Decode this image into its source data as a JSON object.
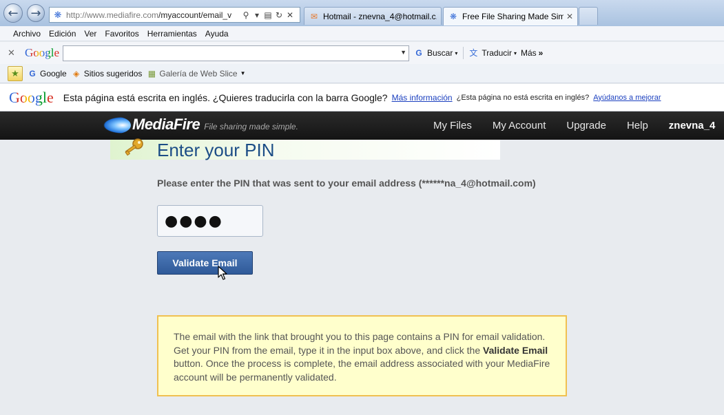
{
  "browser": {
    "address": {
      "url_domain": "http://www.mediafire.com",
      "url_path": "/myaccount/email_v"
    },
    "tabs": [
      {
        "title": "Hotmail - znevna_4@hotmail.c..."
      },
      {
        "title": "Free File Sharing Made Sim..."
      }
    ]
  },
  "menu": {
    "items": [
      "Archivo",
      "Edición",
      "Ver",
      "Favoritos",
      "Herramientas",
      "Ayuda"
    ]
  },
  "google_toolbar": {
    "logo": "Google",
    "search_value": "",
    "buscar_label": "Buscar",
    "traducir_label": "Traducir",
    "mas_label": "Más"
  },
  "favorites": {
    "items": [
      "Google",
      "Sitios sugeridos",
      "Galería de Web Slice"
    ]
  },
  "translate_bar": {
    "logo": "Google",
    "message": "Esta página está escrita en inglés. ¿Quieres traducirla con la barra Google?",
    "more_info": "Más información",
    "not_english": "¿Esta página no está escrita en inglés?",
    "help_improve": "Ayúdanos a mejorar"
  },
  "mediafire": {
    "brand": "MediaFire",
    "tagline": "File sharing made simple.",
    "nav": [
      "My Files",
      "My Account",
      "Upgrade",
      "Help"
    ],
    "user": "znevna_4"
  },
  "page": {
    "title": "Enter your PIN",
    "instruction": "Please enter the PIN that was sent to your email address (******na_4@hotmail.com)",
    "pin_value": "●●●●",
    "validate_button": "Validate Email",
    "info_before": "The email with the link that brought you to this page contains a PIN for email validation. Get your PIN from the email, type it in the input box above, and click the ",
    "info_bold": "Validate Email",
    "info_after": " button. Once the process is complete, the email address associated with your MediaFire account will be permanently validated."
  },
  "colors": {
    "mf_header": "#1c1c1c",
    "title_blue": "#1c4d86",
    "button_blue": "#3a67a8",
    "info_bg": "#ffffcc",
    "info_border": "#f0c050"
  }
}
